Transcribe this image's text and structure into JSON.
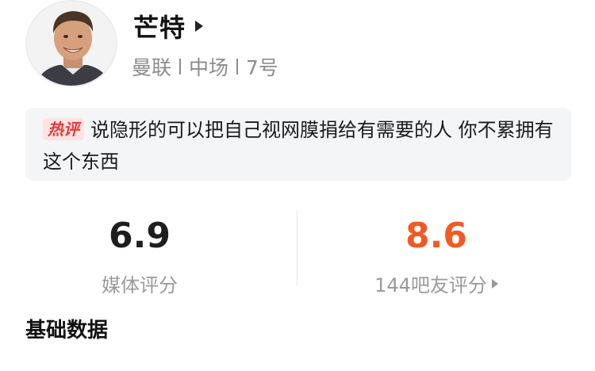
{
  "player": {
    "name": "芒特",
    "club": "曼联",
    "position": "中场",
    "number": "7号"
  },
  "hot_comment": {
    "badge": "热评",
    "text": "说隐形的可以把自己视网膜捐给有需要的人 你不累拥有这个东西"
  },
  "ratings": {
    "media": {
      "score": "6.9",
      "label": "媒体评分"
    },
    "fans": {
      "score": "8.6",
      "label": "144吧友评分"
    }
  },
  "sections": {
    "basic_data_title": "基础数据"
  },
  "colors": {
    "fan_score": "#f15a24",
    "hot_badge_text": "#e8393c",
    "hot_badge_bg": "#fde3e3",
    "card_bg": "#f4f5f7"
  },
  "icons": {
    "name_arrow": "play-arrow-icon",
    "rating_arrow": "play-arrow-icon"
  }
}
